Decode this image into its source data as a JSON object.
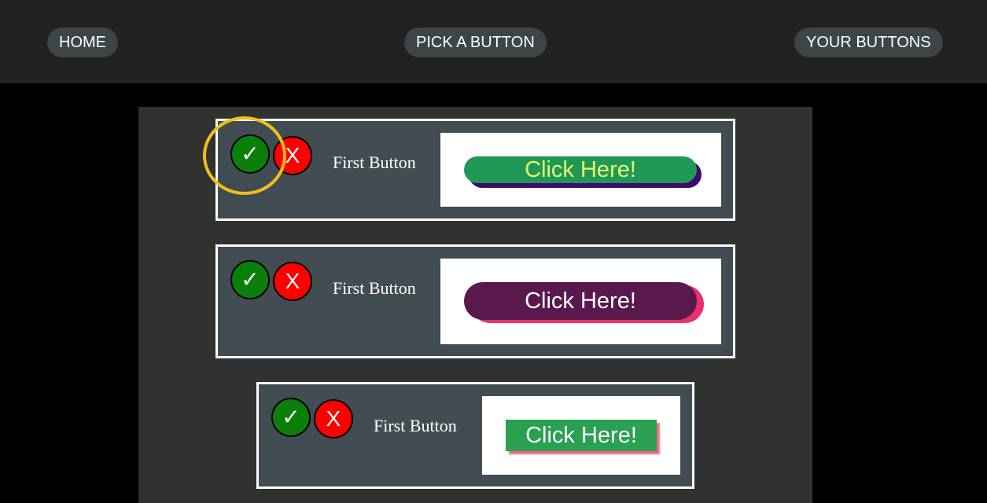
{
  "nav": {
    "home": "HOME",
    "pick": "PICK A BUTTON",
    "yours": "YOUR BUTTONS"
  },
  "icons": {
    "accept": "check-icon",
    "reject": "x-icon"
  },
  "cards": [
    {
      "accept": "✓",
      "reject": "X",
      "label": "First Button",
      "demo_text": "Click Here!"
    },
    {
      "accept": "✓",
      "reject": "X",
      "label": "First Button",
      "demo_text": "Click Here!"
    },
    {
      "accept": "✓",
      "reject": "X",
      "label": "First Button",
      "demo_text": "Click Here!"
    }
  ],
  "colors": {
    "accept": "#0b7f0b",
    "reject": "#ff0000",
    "highlight": "#f3bd1d",
    "demo1_bg": "#229857",
    "demo1_text": "#e3f86e",
    "demo1_shadow": "#3b0a6a",
    "demo2_bg": "#5a194d",
    "demo2_shadow": "#e8306a",
    "demo3_bg": "#29a052",
    "demo3_shadow": "#e96b7f"
  }
}
